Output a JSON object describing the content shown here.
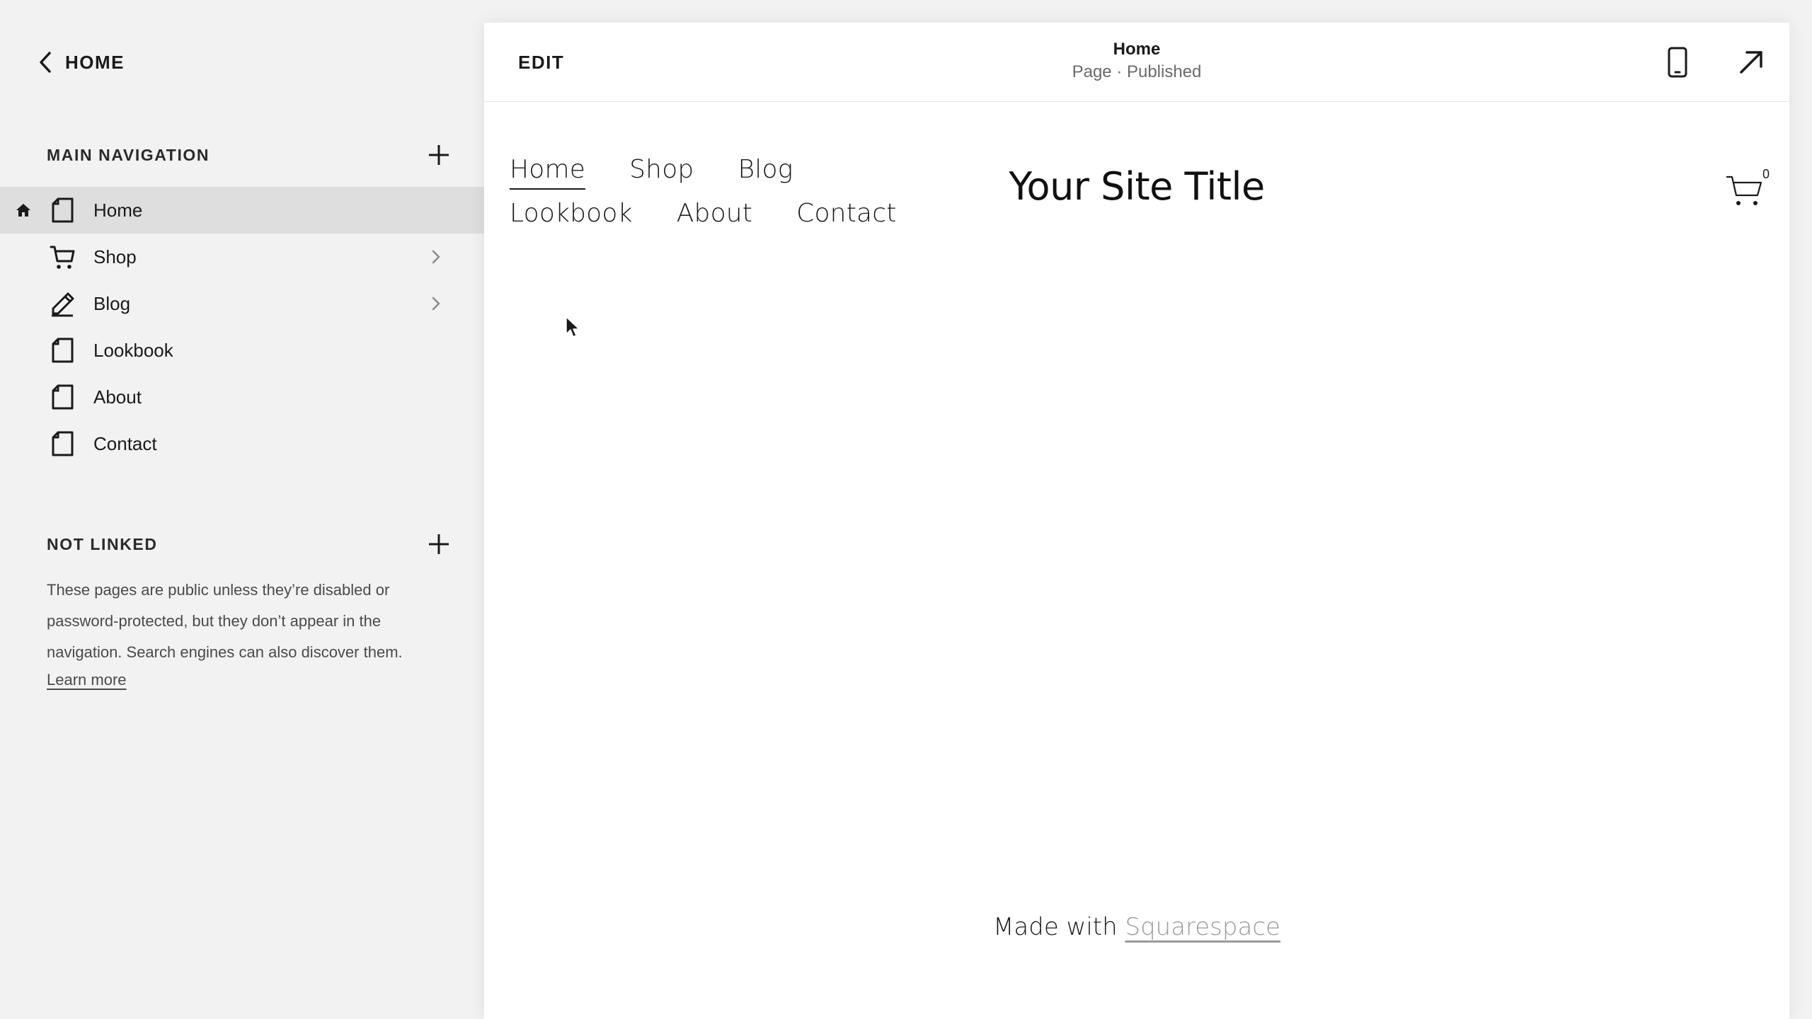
{
  "sidebar": {
    "back_label": "HOME",
    "main_navigation": {
      "title": "MAIN NAVIGATION",
      "items": [
        {
          "label": "Home",
          "icon": "page-icon",
          "active": true,
          "is_homepage": true,
          "has_children": false
        },
        {
          "label": "Shop",
          "icon": "cart-icon",
          "active": false,
          "has_children": true
        },
        {
          "label": "Blog",
          "icon": "blog-edit-icon",
          "active": false,
          "has_children": true
        },
        {
          "label": "Lookbook",
          "icon": "page-icon",
          "active": false,
          "has_children": false
        },
        {
          "label": "About",
          "icon": "page-icon",
          "active": false,
          "has_children": false
        },
        {
          "label": "Contact",
          "icon": "page-icon",
          "active": false,
          "has_children": false
        }
      ]
    },
    "not_linked": {
      "title": "NOT LINKED",
      "description": "These pages are public unless they’re disabled or password-protected, but they don’t appear in the navigation. Search engines can also discover them.",
      "learn_more": "Learn more"
    }
  },
  "preview": {
    "edit_label": "EDIT",
    "page_title": "Home",
    "page_status": "Page · Published",
    "site": {
      "nav_row1": [
        "Home",
        "Shop",
        "Blog"
      ],
      "nav_row2": [
        "Lookbook",
        "About",
        "Contact"
      ],
      "title": "Your Site Title",
      "cart_count": "0"
    },
    "footer": {
      "made_with": "Made with",
      "brand": "Squarespace"
    }
  },
  "colors": {
    "sidebar_bg": "#f2f2f2",
    "active_item_bg": "#dedede",
    "preview_bg": "#ffffff",
    "muted_text": "#6b6b6b",
    "footer_link": "#9a9a9a"
  }
}
